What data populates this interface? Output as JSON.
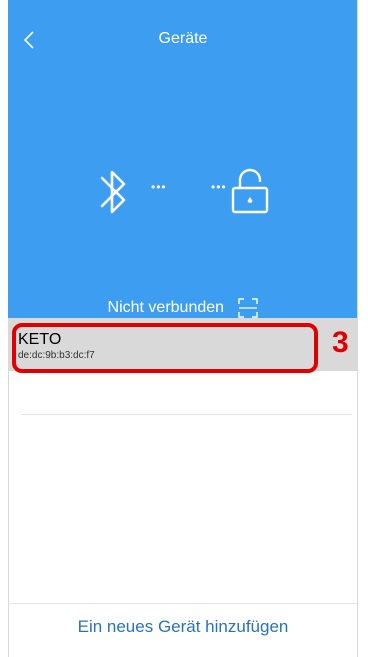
{
  "header": {
    "title": "Geräte",
    "back_icon": "chevron-left-icon"
  },
  "connection": {
    "bluetooth_icon": "bluetooth-icon",
    "lock_icon": "unlocked-padlock-icon",
    "connector_dots": "•••",
    "status": "Nicht verbunden",
    "scan_icon": "scan-frame-icon"
  },
  "devices": [
    {
      "name": "KETO",
      "mac": "de:dc:9b:b3:dc:f7",
      "annotation": "3"
    }
  ],
  "footer": {
    "add_device": "Ein neues Gerät hinzufügen"
  },
  "colors": {
    "primary": "#3d9df1",
    "highlight": "#e00000",
    "link": "#2a72b8"
  }
}
